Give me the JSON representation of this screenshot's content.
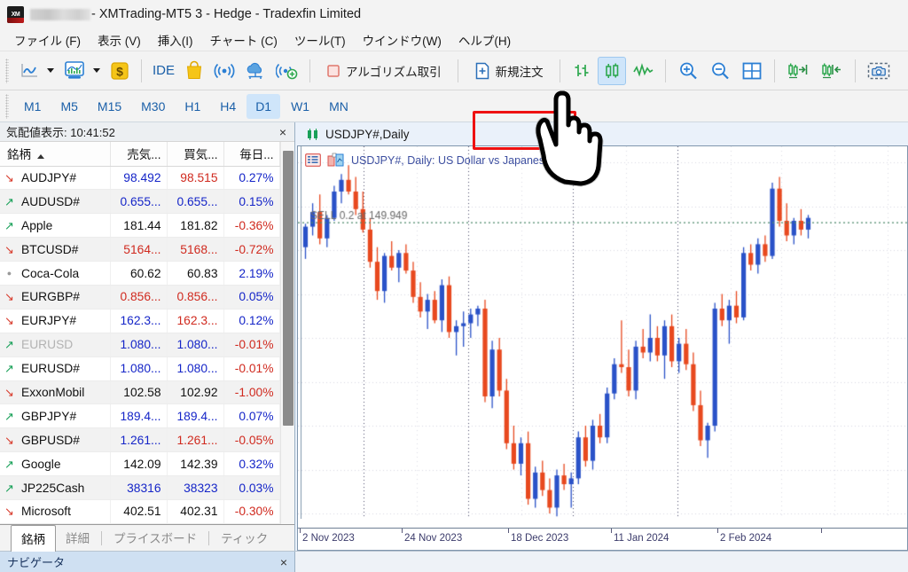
{
  "window": {
    "app_icon": "xm-logo-icon",
    "account_redacted": true,
    "title": "- XMTrading-MT5 3 - Hedge - Tradexfin Limited"
  },
  "menubar": {
    "items": [
      {
        "label": "ファイル (F)",
        "name": "menu-file"
      },
      {
        "label": "表示 (V)",
        "name": "menu-view"
      },
      {
        "label": "挿入(I)",
        "name": "menu-insert"
      },
      {
        "label": "チャート (C)",
        "name": "menu-chart"
      },
      {
        "label": "ツール(T)",
        "name": "menu-tools"
      },
      {
        "label": "ウインドウ(W)",
        "name": "menu-window"
      },
      {
        "label": "ヘルプ(H)",
        "name": "menu-help"
      }
    ]
  },
  "toolbar": {
    "ide_label": "IDE",
    "algo_label": "アルゴリズム取引",
    "new_order_label": "新規注文",
    "highlight_color": "#ee1111",
    "icons": [
      "line-chart-icon",
      "chart-dropdown-caret",
      "indicator-chart-icon",
      "indicator-dropdown-caret",
      "dollar-icon",
      "ide-icon",
      "market-bag-icon",
      "signals-icon",
      "vps-cloud-icon",
      "add-connection-icon",
      "algo-trading-icon",
      "new-order-icon",
      "bar-chart-icon",
      "candlestick-icon",
      "line-graph-icon",
      "zoom-in-icon",
      "zoom-out-icon",
      "grid-icon",
      "auto-scroll-icon",
      "chart-shift-icon",
      "screenshot-icon"
    ]
  },
  "timeframes": {
    "items": [
      "M1",
      "M5",
      "M15",
      "M30",
      "H1",
      "H4",
      "D1",
      "W1",
      "MN"
    ],
    "selected": "D1"
  },
  "market_watch": {
    "title": "気配値表示: 10:41:52",
    "close_label": "×",
    "columns": [
      "銘柄",
      "売気...",
      "買気...",
      "毎日..."
    ],
    "sort_column": "銘柄",
    "sort_direction": "asc",
    "rows": [
      {
        "arrow": "down",
        "symbol": "AUDJPY#",
        "symbol_color": "#111111",
        "bid": "98.492",
        "bid_color": "#1525c8",
        "ask": "98.515",
        "ask_color": "#d02a1f",
        "change": "0.27%",
        "change_color": "#1525c8"
      },
      {
        "arrow": "up",
        "symbol": "AUDUSD#",
        "symbol_color": "#111111",
        "bid": "0.655...",
        "bid_color": "#1525c8",
        "ask": "0.655...",
        "ask_color": "#1525c8",
        "change": "0.15%",
        "change_color": "#1525c8"
      },
      {
        "arrow": "up",
        "symbol": "Apple",
        "symbol_color": "#111111",
        "bid": "181.44",
        "bid_color": "#111111",
        "ask": "181.82",
        "ask_color": "#111111",
        "change": "-0.36%",
        "change_color": "#d02a1f"
      },
      {
        "arrow": "down",
        "symbol": "BTCUSD#",
        "symbol_color": "#111111",
        "bid": "5164...",
        "bid_color": "#d02a1f",
        "ask": "5168...",
        "ask_color": "#d02a1f",
        "change": "-0.72%",
        "change_color": "#d02a1f"
      },
      {
        "arrow": "flat",
        "symbol": "Coca-Cola",
        "symbol_color": "#111111",
        "bid": "60.62",
        "bid_color": "#111111",
        "ask": "60.83",
        "ask_color": "#111111",
        "change": "2.19%",
        "change_color": "#1525c8"
      },
      {
        "arrow": "down",
        "symbol": "EURGBP#",
        "symbol_color": "#111111",
        "bid": "0.856...",
        "bid_color": "#d02a1f",
        "ask": "0.856...",
        "ask_color": "#d02a1f",
        "change": "0.05%",
        "change_color": "#1525c8"
      },
      {
        "arrow": "down",
        "symbol": "EURJPY#",
        "symbol_color": "#111111",
        "bid": "162.3...",
        "bid_color": "#1525c8",
        "ask": "162.3...",
        "ask_color": "#d02a1f",
        "change": "0.12%",
        "change_color": "#1525c8"
      },
      {
        "arrow": "up",
        "symbol": "EURUSD",
        "symbol_color": "#b3b3b3",
        "bid": "1.080...",
        "bid_color": "#1525c8",
        "ask": "1.080...",
        "ask_color": "#1525c8",
        "change": "-0.01%",
        "change_color": "#d02a1f"
      },
      {
        "arrow": "up",
        "symbol": "EURUSD#",
        "symbol_color": "#111111",
        "bid": "1.080...",
        "bid_color": "#1525c8",
        "ask": "1.080...",
        "ask_color": "#1525c8",
        "change": "-0.01%",
        "change_color": "#d02a1f"
      },
      {
        "arrow": "down",
        "symbol": "ExxonMobil",
        "symbol_color": "#111111",
        "bid": "102.58",
        "bid_color": "#111111",
        "ask": "102.92",
        "ask_color": "#111111",
        "change": "-1.00%",
        "change_color": "#d02a1f"
      },
      {
        "arrow": "up",
        "symbol": "GBPJPY#",
        "symbol_color": "#111111",
        "bid": "189.4...",
        "bid_color": "#1525c8",
        "ask": "189.4...",
        "ask_color": "#1525c8",
        "change": "0.07%",
        "change_color": "#1525c8"
      },
      {
        "arrow": "down",
        "symbol": "GBPUSD#",
        "symbol_color": "#111111",
        "bid": "1.261...",
        "bid_color": "#1525c8",
        "ask": "1.261...",
        "ask_color": "#d02a1f",
        "change": "-0.05%",
        "change_color": "#d02a1f"
      },
      {
        "arrow": "up",
        "symbol": "Google",
        "symbol_color": "#111111",
        "bid": "142.09",
        "bid_color": "#111111",
        "ask": "142.39",
        "ask_color": "#111111",
        "change": "0.32%",
        "change_color": "#1525c8"
      },
      {
        "arrow": "up",
        "symbol": "JP225Cash",
        "symbol_color": "#111111",
        "bid": "38316",
        "bid_color": "#1525c8",
        "ask": "38323",
        "ask_color": "#1525c8",
        "change": "0.03%",
        "change_color": "#1525c8"
      },
      {
        "arrow": "down",
        "symbol": "Microsoft",
        "symbol_color": "#111111",
        "bid": "402.51",
        "bid_color": "#111111",
        "ask": "402.31",
        "ask_color": "#111111",
        "change": "-0.30%",
        "change_color": "#d02a1f"
      }
    ],
    "tabs": [
      {
        "label": "銘柄",
        "selected": true
      },
      {
        "label": "詳細",
        "selected": false
      },
      {
        "label": "プライスボード",
        "selected": false
      },
      {
        "label": "ティック",
        "selected": false
      }
    ]
  },
  "chart": {
    "tab_label": "USDJPY#,Daily",
    "watermark": "USDJPY#, Daily:  US Dollar vs Japanese",
    "sell_line_label": "SELL 0.2 at 149.949",
    "sell_line_color": "#4e8b6b",
    "bull_color": "#2a52c8",
    "bear_color": "#e8491f",
    "x_labels": [
      "2 Nov 2023",
      "24 Nov 2023",
      "18 Dec 2023",
      "11 Jan 2024",
      "2 Feb 2024"
    ],
    "x_label_positions": [
      2,
      117,
      237,
      353,
      473
    ],
    "x_tick_positions": [
      2,
      117,
      237,
      353,
      473,
      590
    ]
  },
  "navigator": {
    "title": "ナビゲータ",
    "close_label": "×"
  },
  "cursor": {
    "type": "pointing-hand"
  },
  "chart_data": {
    "type": "candlestick",
    "title": "USDJPY#, Daily: US Dollar vs Japanese",
    "sell_level": 149.949,
    "sell_volume": 0.2,
    "ylim": [
      140.0,
      152.0
    ],
    "candles": [
      [
        149.1,
        149.9,
        148.7,
        149.8
      ],
      [
        149.8,
        150.6,
        149.5,
        150.3
      ],
      [
        150.3,
        150.9,
        149.2,
        149.4
      ],
      [
        149.4,
        150.2,
        149.1,
        150.1
      ],
      [
        150.1,
        151.2,
        150.0,
        151.0
      ],
      [
        151.0,
        151.6,
        150.6,
        151.4
      ],
      [
        151.4,
        151.9,
        150.9,
        151.0
      ],
      [
        151.0,
        151.5,
        150.2,
        150.4
      ],
      [
        150.4,
        151.0,
        149.6,
        149.7
      ],
      [
        149.7,
        150.1,
        148.4,
        148.6
      ],
      [
        148.6,
        149.1,
        147.3,
        147.6
      ],
      [
        147.6,
        148.9,
        147.2,
        148.8
      ],
      [
        148.8,
        149.3,
        148.3,
        148.4
      ],
      [
        148.4,
        149.0,
        147.9,
        148.9
      ],
      [
        148.9,
        149.2,
        148.2,
        148.3
      ],
      [
        148.3,
        148.6,
        147.2,
        147.4
      ],
      [
        147.4,
        147.9,
        146.7,
        146.9
      ],
      [
        146.9,
        147.5,
        146.3,
        147.3
      ],
      [
        147.3,
        147.6,
        146.5,
        146.6
      ],
      [
        146.6,
        148.0,
        146.2,
        147.8
      ],
      [
        147.8,
        148.1,
        146.0,
        146.2
      ],
      [
        146.2,
        146.6,
        145.4,
        146.4
      ],
      [
        146.4,
        146.9,
        145.7,
        146.5
      ],
      [
        146.5,
        147.0,
        146.0,
        146.8
      ],
      [
        146.8,
        147.1,
        146.4,
        147.0
      ],
      [
        147.0,
        147.3,
        143.8,
        144.0
      ],
      [
        144.0,
        145.9,
        143.6,
        145.6
      ],
      [
        145.6,
        146.0,
        144.0,
        144.2
      ],
      [
        144.2,
        144.6,
        142.2,
        142.4
      ],
      [
        142.4,
        143.0,
        141.5,
        141.7
      ],
      [
        141.7,
        142.6,
        141.3,
        142.4
      ],
      [
        142.4,
        142.8,
        140.3,
        140.5
      ],
      [
        140.5,
        141.6,
        140.2,
        141.4
      ],
      [
        141.4,
        141.8,
        140.6,
        140.8
      ],
      [
        140.8,
        141.2,
        140.0,
        140.2
      ],
      [
        140.2,
        141.5,
        139.9,
        141.3
      ],
      [
        141.3,
        141.7,
        140.8,
        141.0
      ],
      [
        141.0,
        141.4,
        140.2,
        141.2
      ],
      [
        141.2,
        142.8,
        141.0,
        142.6
      ],
      [
        142.6,
        143.0,
        141.6,
        141.8
      ],
      [
        141.8,
        143.2,
        141.5,
        143.0
      ],
      [
        143.0,
        143.4,
        142.4,
        142.6
      ],
      [
        142.6,
        144.3,
        142.4,
        144.1
      ],
      [
        144.1,
        145.3,
        143.9,
        145.1
      ],
      [
        145.1,
        146.6,
        144.8,
        145.0
      ],
      [
        145.0,
        145.6,
        144.0,
        144.2
      ],
      [
        144.2,
        145.9,
        143.9,
        145.7
      ],
      [
        145.7,
        146.3,
        145.3,
        145.5
      ],
      [
        145.5,
        146.8,
        145.2,
        146.0
      ],
      [
        146.0,
        146.4,
        145.2,
        145.4
      ],
      [
        145.4,
        146.6,
        144.6,
        146.4
      ],
      [
        146.4,
        146.8,
        145.0,
        145.2
      ],
      [
        145.2,
        146.0,
        144.8,
        145.8
      ],
      [
        145.8,
        146.3,
        144.9,
        145.1
      ],
      [
        145.1,
        145.5,
        143.5,
        143.7
      ],
      [
        143.7,
        144.2,
        142.3,
        142.5
      ],
      [
        142.5,
        143.1,
        141.9,
        143.0
      ],
      [
        143.0,
        147.2,
        142.8,
        147.0
      ],
      [
        147.0,
        147.5,
        146.4,
        146.6
      ],
      [
        146.6,
        147.3,
        145.8,
        147.1
      ],
      [
        147.1,
        147.6,
        146.5,
        146.7
      ],
      [
        146.7,
        149.1,
        146.6,
        148.9
      ],
      [
        148.9,
        149.2,
        148.3,
        148.5
      ],
      [
        148.5,
        149.4,
        148.2,
        149.2
      ],
      [
        149.2,
        149.5,
        148.6,
        148.8
      ],
      [
        148.8,
        151.3,
        148.7,
        151.1
      ],
      [
        151.1,
        151.5,
        149.8,
        150.0
      ],
      [
        150.0,
        150.6,
        149.3,
        149.5
      ],
      [
        149.5,
        150.1,
        149.2,
        150.0
      ],
      [
        150.0,
        150.4,
        149.5,
        149.7
      ],
      [
        149.7,
        150.2,
        149.4,
        150.1
      ]
    ]
  }
}
